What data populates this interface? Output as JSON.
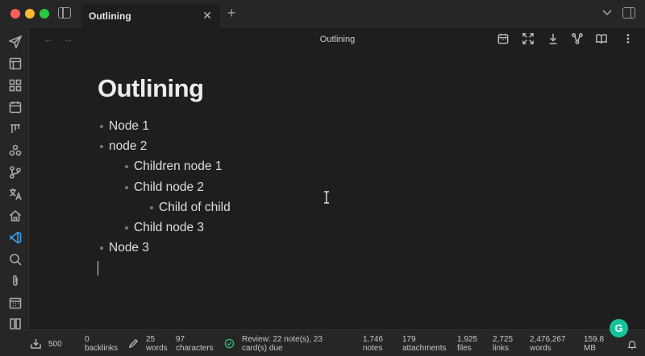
{
  "tabs": [
    {
      "title": "Outlining"
    }
  ],
  "view": {
    "title": "Outlining"
  },
  "note": {
    "title": "Outlining",
    "bullets": [
      {
        "text": "Node 1",
        "level": 0
      },
      {
        "text": "node 2",
        "level": 0
      },
      {
        "text": "Children node 1",
        "level": 1
      },
      {
        "text": "Child node 2",
        "level": 1
      },
      {
        "text": "Child of child",
        "level": 2
      },
      {
        "text": "Child node 3",
        "level": 1
      },
      {
        "text": "Node 3",
        "level": 0
      }
    ]
  },
  "statusbar": {
    "sync_count": "500",
    "backlinks": {
      "value": "0",
      "label": "backlinks"
    },
    "words": {
      "value": "25",
      "label": "words"
    },
    "characters": {
      "value": "97",
      "label": "characters"
    },
    "review": {
      "line1": "Review: 22 note(s), 23",
      "line2": "card(s) due"
    },
    "notes": {
      "value": "1,746",
      "label": "notes"
    },
    "attachments": {
      "value": "179",
      "label": "attachments"
    },
    "files": {
      "value": "1,925",
      "label": "files"
    },
    "links": {
      "value": "2,725",
      "label": "links"
    },
    "vault_words": {
      "value": "2,476,267",
      "label": "words"
    },
    "size": {
      "value": "159.8",
      "label": "MB"
    }
  },
  "icons": {
    "ribbon": [
      "send-icon",
      "layout-icon",
      "grid-icon",
      "calendar-icon",
      "kanban-icon",
      "graph-icon",
      "git-icon",
      "translate-icon",
      "home-icon",
      "vscode-icon",
      "search-icon",
      "paperclip-icon",
      "calendar-days-icon",
      "book-icon"
    ],
    "header": [
      "calendar-icon",
      "expand-icon",
      "download-icon",
      "share-nodes-icon",
      "reading-view-icon",
      "more-options-icon"
    ]
  },
  "colors": {
    "accent": "#15c39a",
    "background": "#1e1e1e",
    "chrome": "#262626"
  }
}
